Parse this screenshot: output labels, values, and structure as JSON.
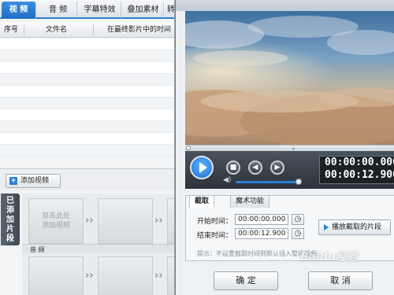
{
  "main": {
    "tabs": [
      {
        "label": "视 频"
      },
      {
        "label": "音 频"
      },
      {
        "label": "字幕特效"
      },
      {
        "label": "叠加素材"
      },
      {
        "label": "转"
      }
    ],
    "table": {
      "headers": [
        "序号",
        "文件名",
        "在最终影片中的时间"
      ]
    },
    "add_video_button": "添加视频",
    "side_tab": "已添加片段",
    "timeline": {
      "placeholder": "双击此处\n添加视频",
      "audio_label": "音 频"
    }
  },
  "dialog": {
    "time_current": "00:00:00.000",
    "time_total": "00:00:12.900",
    "tabs": [
      "截取",
      "魔术功能"
    ],
    "start_label": "开始时间：",
    "start_value": "00:00:00.000",
    "end_label": "结束时间：",
    "end_value": "00:00:12.900",
    "play_selection_button": "播放截取的片段",
    "hint": "提示：不设置截取时间则默认插入整段视频。",
    "ok_button": "确 定",
    "cancel_button": "取 消"
  },
  "watermark": "Baidu经验",
  "colors": {
    "accent": "#2a7fd4",
    "video_area_bg": "#2c333a"
  }
}
